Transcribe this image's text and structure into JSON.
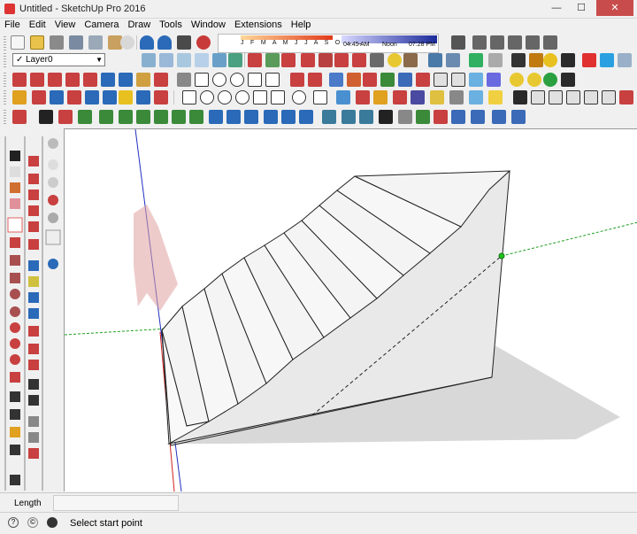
{
  "window": {
    "title": "Untitled - SketchUp Pro 2016",
    "minimize_glyph": "—",
    "maximize_glyph": "☐",
    "close_glyph": "✕"
  },
  "menu": [
    "File",
    "Edit",
    "View",
    "Camera",
    "Draw",
    "Tools",
    "Window",
    "Extensions",
    "Help"
  ],
  "shadow_settings": {
    "months_label": "J F M A M J J A S O N D",
    "time_start": "04:45 AM",
    "time_noon": "Noon",
    "time_end": "07:28 PM"
  },
  "layers": {
    "current": "Layer0",
    "check_glyph": "✓",
    "dropdown_glyph": "▼"
  },
  "vcb": {
    "label": "Length",
    "value": ""
  },
  "status": {
    "hint": "Select start point"
  },
  "colors": {
    "axis_red": "#d02020",
    "axis_green": "#20a020",
    "axis_blue": "#2030c0",
    "model_face": "#f2f2f2",
    "model_side": "#e4e4e4",
    "shadow": "#c8c8c8"
  }
}
